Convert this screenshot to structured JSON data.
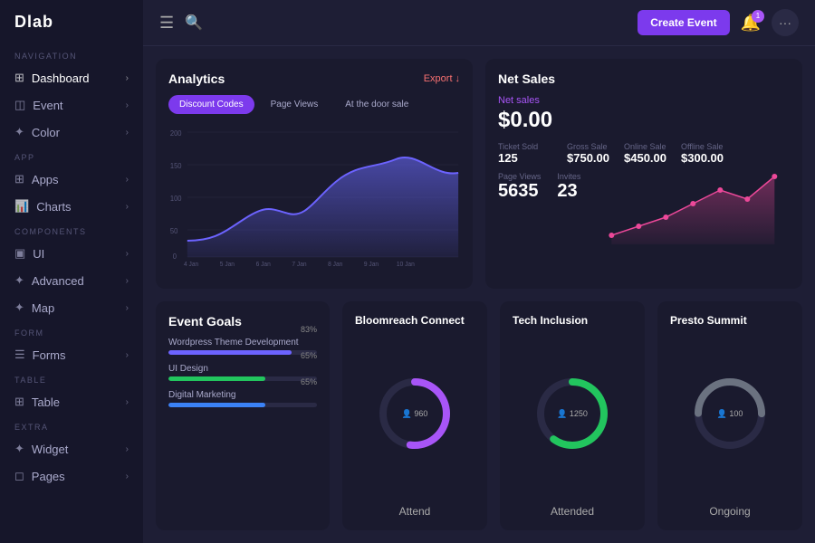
{
  "sidebar": {
    "logo": "Dlab",
    "sections": [
      {
        "label": "NAVIGATION",
        "items": [
          {
            "icon": "⊞",
            "label": "Dashboard",
            "id": "dashboard"
          },
          {
            "icon": "◫",
            "label": "Event",
            "id": "event"
          },
          {
            "icon": "✦",
            "label": "Color",
            "id": "color"
          }
        ]
      },
      {
        "label": "APP",
        "items": [
          {
            "icon": "⊞",
            "label": "Apps",
            "id": "apps"
          },
          {
            "icon": "📊",
            "label": "Charts",
            "id": "charts"
          }
        ]
      },
      {
        "label": "COMPONENTS",
        "items": [
          {
            "icon": "▣",
            "label": "UI",
            "id": "ui"
          },
          {
            "icon": "✦",
            "label": "Advanced",
            "id": "advanced"
          },
          {
            "icon": "✦",
            "label": "Map",
            "id": "map"
          }
        ]
      },
      {
        "label": "FORM",
        "items": [
          {
            "icon": "☰",
            "label": "Forms",
            "id": "forms"
          }
        ]
      },
      {
        "label": "TABLE",
        "items": [
          {
            "icon": "⊞",
            "label": "Table",
            "id": "table"
          }
        ]
      },
      {
        "label": "EXTRA",
        "items": [
          {
            "icon": "✦",
            "label": "Widget",
            "id": "widget"
          },
          {
            "icon": "◻",
            "label": "Pages",
            "id": "pages"
          }
        ]
      }
    ]
  },
  "topbar": {
    "create_event": "Create Event",
    "notification_count": "1",
    "dots": "···"
  },
  "analytics": {
    "title": "Analytics",
    "export_label": "Export",
    "tabs": [
      "Discount Codes",
      "Page Views",
      "At the door sale"
    ],
    "active_tab": 0,
    "x_labels": [
      "4 Jan",
      "5 Jan",
      "6 Jan",
      "7 Jan",
      "8 Jan",
      "9 Jan",
      "10 Jan"
    ],
    "y_labels": [
      "0",
      "50",
      "100",
      "150",
      "200"
    ]
  },
  "net_sales": {
    "title": "Net Sales",
    "sales_label": "Net sales",
    "sales_value": "$0.00",
    "ticket_sold_label": "Ticket Sold",
    "ticket_sold_value": "125",
    "gross_sale_label": "Gross Sale",
    "gross_sale_value": "$750.00",
    "online_sale_label": "Online Sale",
    "online_sale_value": "$450.00",
    "offline_sale_label": "Offline Sale",
    "offline_sale_value": "$300.00",
    "page_views_label": "Page Views",
    "page_views_value": "5635",
    "invites_label": "Invites",
    "invites_value": "23"
  },
  "event_goals": {
    "title": "Event Goals",
    "goals": [
      {
        "label": "Wordpress Theme Development",
        "pct": 83,
        "color": "#6c63ff"
      },
      {
        "label": "UI Design",
        "pct": 65,
        "color": "#22c55e"
      },
      {
        "label": "Digital Marketing",
        "pct": 65,
        "color": "#3b82f6"
      }
    ]
  },
  "bloomreach": {
    "title": "Bloomreach Connect",
    "value": "960",
    "icon": "👤",
    "label": "Attend",
    "color": "#a855f7",
    "pct": 72
  },
  "tech_inclusion": {
    "title": "Tech Inclusion",
    "value": "1250",
    "icon": "👤",
    "label": "Attended",
    "color": "#22c55e",
    "pct": 80
  },
  "presto_summit": {
    "title": "Presto Summit",
    "value": "100",
    "icon": "👤",
    "label": "Ongoing",
    "color": "#6b7280",
    "pct": 50
  }
}
